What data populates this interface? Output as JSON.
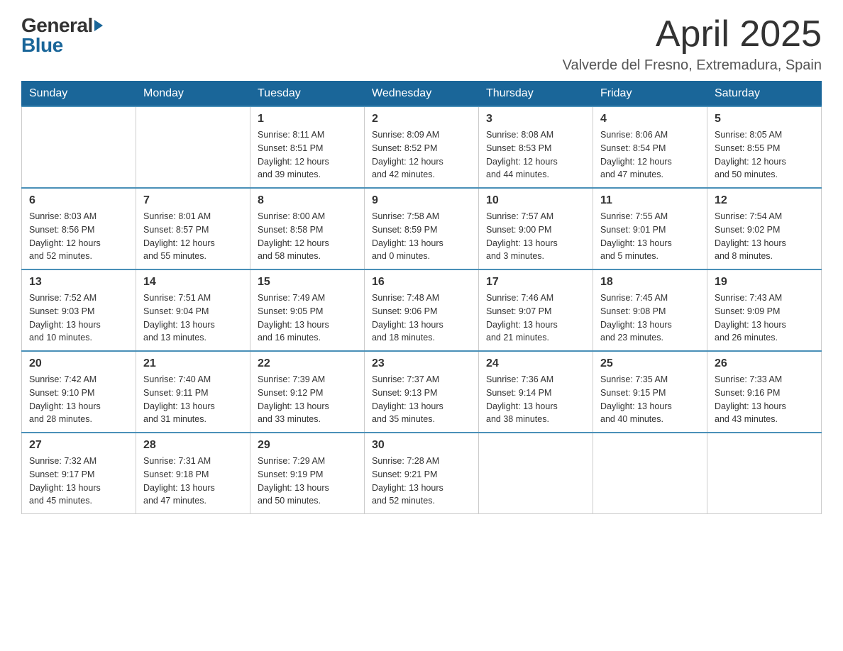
{
  "header": {
    "logo_line1": "General",
    "logo_line2": "Blue",
    "month_title": "April 2025",
    "location": "Valverde del Fresno, Extremadura, Spain"
  },
  "days_of_week": [
    "Sunday",
    "Monday",
    "Tuesday",
    "Wednesday",
    "Thursday",
    "Friday",
    "Saturday"
  ],
  "weeks": [
    [
      {
        "day": "",
        "info": ""
      },
      {
        "day": "",
        "info": ""
      },
      {
        "day": "1",
        "info": "Sunrise: 8:11 AM\nSunset: 8:51 PM\nDaylight: 12 hours\nand 39 minutes."
      },
      {
        "day": "2",
        "info": "Sunrise: 8:09 AM\nSunset: 8:52 PM\nDaylight: 12 hours\nand 42 minutes."
      },
      {
        "day": "3",
        "info": "Sunrise: 8:08 AM\nSunset: 8:53 PM\nDaylight: 12 hours\nand 44 minutes."
      },
      {
        "day": "4",
        "info": "Sunrise: 8:06 AM\nSunset: 8:54 PM\nDaylight: 12 hours\nand 47 minutes."
      },
      {
        "day": "5",
        "info": "Sunrise: 8:05 AM\nSunset: 8:55 PM\nDaylight: 12 hours\nand 50 minutes."
      }
    ],
    [
      {
        "day": "6",
        "info": "Sunrise: 8:03 AM\nSunset: 8:56 PM\nDaylight: 12 hours\nand 52 minutes."
      },
      {
        "day": "7",
        "info": "Sunrise: 8:01 AM\nSunset: 8:57 PM\nDaylight: 12 hours\nand 55 minutes."
      },
      {
        "day": "8",
        "info": "Sunrise: 8:00 AM\nSunset: 8:58 PM\nDaylight: 12 hours\nand 58 minutes."
      },
      {
        "day": "9",
        "info": "Sunrise: 7:58 AM\nSunset: 8:59 PM\nDaylight: 13 hours\nand 0 minutes."
      },
      {
        "day": "10",
        "info": "Sunrise: 7:57 AM\nSunset: 9:00 PM\nDaylight: 13 hours\nand 3 minutes."
      },
      {
        "day": "11",
        "info": "Sunrise: 7:55 AM\nSunset: 9:01 PM\nDaylight: 13 hours\nand 5 minutes."
      },
      {
        "day": "12",
        "info": "Sunrise: 7:54 AM\nSunset: 9:02 PM\nDaylight: 13 hours\nand 8 minutes."
      }
    ],
    [
      {
        "day": "13",
        "info": "Sunrise: 7:52 AM\nSunset: 9:03 PM\nDaylight: 13 hours\nand 10 minutes."
      },
      {
        "day": "14",
        "info": "Sunrise: 7:51 AM\nSunset: 9:04 PM\nDaylight: 13 hours\nand 13 minutes."
      },
      {
        "day": "15",
        "info": "Sunrise: 7:49 AM\nSunset: 9:05 PM\nDaylight: 13 hours\nand 16 minutes."
      },
      {
        "day": "16",
        "info": "Sunrise: 7:48 AM\nSunset: 9:06 PM\nDaylight: 13 hours\nand 18 minutes."
      },
      {
        "day": "17",
        "info": "Sunrise: 7:46 AM\nSunset: 9:07 PM\nDaylight: 13 hours\nand 21 minutes."
      },
      {
        "day": "18",
        "info": "Sunrise: 7:45 AM\nSunset: 9:08 PM\nDaylight: 13 hours\nand 23 minutes."
      },
      {
        "day": "19",
        "info": "Sunrise: 7:43 AM\nSunset: 9:09 PM\nDaylight: 13 hours\nand 26 minutes."
      }
    ],
    [
      {
        "day": "20",
        "info": "Sunrise: 7:42 AM\nSunset: 9:10 PM\nDaylight: 13 hours\nand 28 minutes."
      },
      {
        "day": "21",
        "info": "Sunrise: 7:40 AM\nSunset: 9:11 PM\nDaylight: 13 hours\nand 31 minutes."
      },
      {
        "day": "22",
        "info": "Sunrise: 7:39 AM\nSunset: 9:12 PM\nDaylight: 13 hours\nand 33 minutes."
      },
      {
        "day": "23",
        "info": "Sunrise: 7:37 AM\nSunset: 9:13 PM\nDaylight: 13 hours\nand 35 minutes."
      },
      {
        "day": "24",
        "info": "Sunrise: 7:36 AM\nSunset: 9:14 PM\nDaylight: 13 hours\nand 38 minutes."
      },
      {
        "day": "25",
        "info": "Sunrise: 7:35 AM\nSunset: 9:15 PM\nDaylight: 13 hours\nand 40 minutes."
      },
      {
        "day": "26",
        "info": "Sunrise: 7:33 AM\nSunset: 9:16 PM\nDaylight: 13 hours\nand 43 minutes."
      }
    ],
    [
      {
        "day": "27",
        "info": "Sunrise: 7:32 AM\nSunset: 9:17 PM\nDaylight: 13 hours\nand 45 minutes."
      },
      {
        "day": "28",
        "info": "Sunrise: 7:31 AM\nSunset: 9:18 PM\nDaylight: 13 hours\nand 47 minutes."
      },
      {
        "day": "29",
        "info": "Sunrise: 7:29 AM\nSunset: 9:19 PM\nDaylight: 13 hours\nand 50 minutes."
      },
      {
        "day": "30",
        "info": "Sunrise: 7:28 AM\nSunset: 9:21 PM\nDaylight: 13 hours\nand 52 minutes."
      },
      {
        "day": "",
        "info": ""
      },
      {
        "day": "",
        "info": ""
      },
      {
        "day": "",
        "info": ""
      }
    ]
  ]
}
